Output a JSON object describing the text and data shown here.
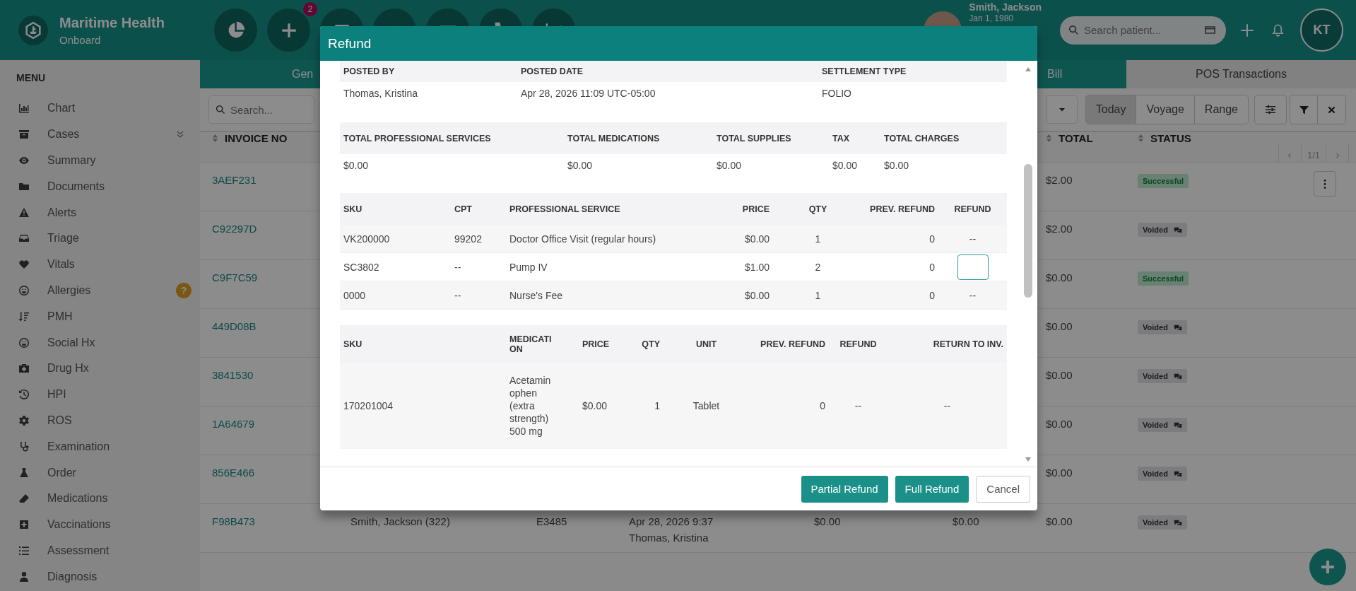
{
  "app": {
    "name": "Maritime Health",
    "subtitle": "Onboard"
  },
  "toolbar": {
    "badge": "2"
  },
  "patient": {
    "name": "Smith, Jackson",
    "dob": "Jan 1, 1980"
  },
  "patient_search": {
    "placeholder": "Search patient..."
  },
  "user": {
    "initials": "KT"
  },
  "menu": {
    "title": "MENU",
    "items": [
      {
        "label": "Chart",
        "expandable": false
      },
      {
        "label": "Cases",
        "expandable": true
      },
      {
        "label": "Summary",
        "expandable": false
      },
      {
        "label": "Documents",
        "expandable": false
      },
      {
        "label": "Alerts",
        "expandable": false
      },
      {
        "label": "Triage",
        "expandable": false
      },
      {
        "label": "Vitals",
        "expandable": false
      },
      {
        "label": "Allergies",
        "expandable": false,
        "badge": "?"
      },
      {
        "label": "PMH",
        "expandable": false
      },
      {
        "label": "Social Hx",
        "expandable": false
      },
      {
        "label": "Drug Hx",
        "expandable": false
      },
      {
        "label": "HPI",
        "expandable": false
      },
      {
        "label": "ROS",
        "expandable": false
      },
      {
        "label": "Examination",
        "expandable": false
      },
      {
        "label": "Order",
        "expandable": false
      },
      {
        "label": "Medications",
        "expandable": false
      },
      {
        "label": "Vaccinations",
        "expandable": false
      },
      {
        "label": "Assessment",
        "expandable": false
      },
      {
        "label": "Diagnosis",
        "expandable": false
      }
    ]
  },
  "tabs": [
    {
      "label": "Gen",
      "selected": false
    },
    {
      "label": "Bill",
      "selected": false
    },
    {
      "label": "POS Transactions",
      "selected": true
    }
  ],
  "search": {
    "placeholder": "Search..."
  },
  "range_buttons": [
    {
      "label": "Today",
      "selected": true
    },
    {
      "label": "Voyage",
      "selected": false
    },
    {
      "label": "Range",
      "selected": false
    }
  ],
  "table": {
    "columns": {
      "invoice_no": "INVOICE NO",
      "total": "TOTAL",
      "status": "STATUS"
    },
    "pager": "1/1",
    "rows": [
      {
        "invoice_no": "3AEF231",
        "total": "$2.00",
        "status": {
          "label": "Successful",
          "kind": "success"
        },
        "menu_button": true
      },
      {
        "invoice_no": "C92297D",
        "total": "$2.00",
        "status": {
          "label": "Voided",
          "kind": "voided"
        },
        "menu_button": false
      },
      {
        "invoice_no": "C9F7C59",
        "total": "$0.00",
        "status": {
          "label": "Successful",
          "kind": "success"
        },
        "menu_button": false
      },
      {
        "invoice_no": "449D08B",
        "total": "$0.00",
        "status": {
          "label": "Voided",
          "kind": "voided"
        },
        "menu_button": false
      },
      {
        "invoice_no": "3841530",
        "total": "$0.00",
        "status": {
          "label": "Voided",
          "kind": "voided"
        },
        "menu_button": false
      },
      {
        "invoice_no": "1A64679",
        "total": "$0.00",
        "status": {
          "label": "Voided",
          "kind": "voided"
        },
        "menu_button": false
      },
      {
        "invoice_no": "856E466",
        "total": "$0.00",
        "status": {
          "label": "Voided",
          "kind": "voided"
        },
        "menu_button": false
      },
      {
        "invoice_no": "F98B473",
        "column_2": "Smith, Jackson (322)",
        "column_3": "E3485",
        "column_4": [
          "Apr 28, 2026 9:37",
          "Thomas, Kristina"
        ],
        "column_5": "$0.00",
        "column_6": "$0.00",
        "total": "$0.00",
        "status": {
          "label": "Voided",
          "kind": "voided"
        },
        "menu_button": false
      }
    ]
  },
  "modal": {
    "title": "Refund",
    "info": {
      "columns": [
        "POSTED BY",
        "POSTED DATE",
        "SETTLEMENT TYPE"
      ],
      "values": [
        "Thomas, Kristina",
        "Apr 28, 2026 11:09 UTC-05:00",
        "FOLIO"
      ]
    },
    "totals": {
      "columns": [
        "TOTAL PROFESSIONAL SERVICES",
        "TOTAL MEDICATIONS",
        "TOTAL SUPPLIES",
        "TAX",
        "TOTAL CHARGES"
      ],
      "values": [
        "$0.00",
        "$0.00",
        "$0.00",
        "$0.00",
        "$0.00"
      ]
    },
    "services": {
      "columns": [
        "SKU",
        "CPT",
        "PROFESSIONAL SERVICE",
        "PRICE",
        "QTY",
        "PREV. REFUND",
        "REFUND"
      ],
      "rows": [
        {
          "sku": "VK200000",
          "cpt": "99202",
          "service": "Doctor Office Visit (regular hours)",
          "price": "$0.00",
          "qty": "1",
          "prev_refund": "0",
          "editable": false,
          "refund": "--"
        },
        {
          "sku": "SC3802",
          "cpt": "--",
          "service": "Pump IV",
          "price": "$1.00",
          "qty": "2",
          "prev_refund": "0",
          "editable": true
        },
        {
          "sku": "0000",
          "cpt": "--",
          "service": "Nurse's Fee",
          "price": "$0.00",
          "qty": "1",
          "prev_refund": "0",
          "editable": false,
          "refund": "--"
        }
      ]
    },
    "medications": {
      "columns": [
        "SKU",
        "MEDICATION",
        "PRICE",
        "QTY",
        "UNIT",
        "PREV. REFUND",
        "REFUND",
        "RETURN TO INV."
      ],
      "rows": [
        {
          "sku": "170201004",
          "medication": "Acetaminophen (extra strength) 500 mg",
          "price": "$0.00",
          "qty": "1",
          "unit": "Tablet",
          "prev_refund": "0",
          "refund": "--",
          "return_to_inv": "--"
        }
      ]
    },
    "buttons": [
      {
        "label": "Partial Refund",
        "kind": "primary"
      },
      {
        "label": "Full Refund",
        "kind": "primary"
      },
      {
        "label": "Cancel",
        "kind": "secondary"
      }
    ]
  }
}
